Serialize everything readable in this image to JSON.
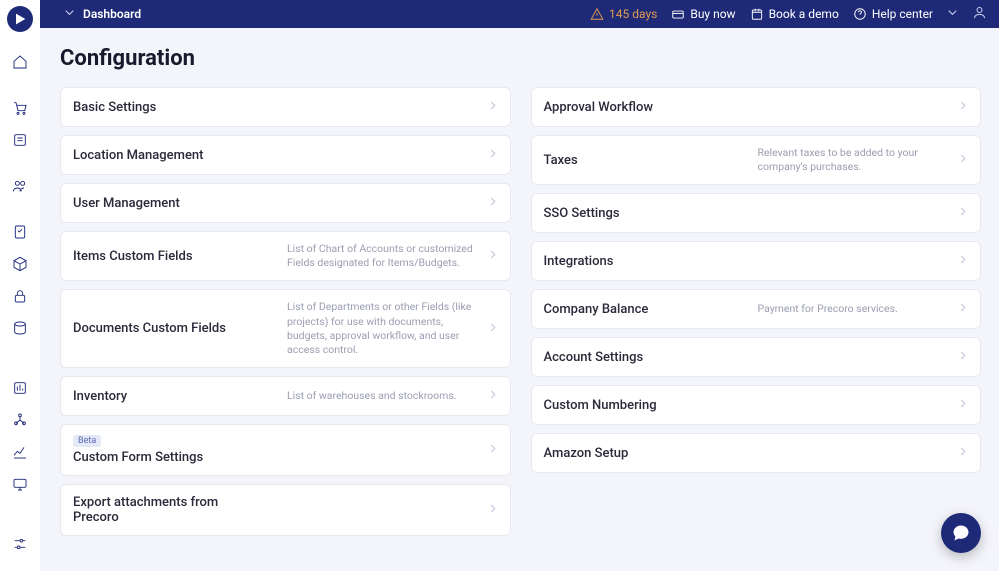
{
  "breadcrumb": "Dashboard",
  "topbar": {
    "trial": "145 days",
    "buy": "Buy now",
    "demo": "Book a demo",
    "help": "Help center"
  },
  "page": {
    "title": "Configuration"
  },
  "left_cards": [
    {
      "title": "Basic Settings",
      "desc": ""
    },
    {
      "title": "Location Management",
      "desc": ""
    },
    {
      "title": "User Management",
      "desc": ""
    },
    {
      "title": "Items Custom Fields",
      "desc": "List of Chart of Accounts or customized Fields designated for Items/Budgets."
    },
    {
      "title": "Documents Custom Fields",
      "desc": "List of Departments or other Fields (like projects) for use with documents, budgets, approval workflow, and user access control."
    },
    {
      "title": "Inventory",
      "desc": "List of warehouses and stockrooms."
    },
    {
      "title": "Custom Form Settings",
      "desc": "",
      "badge": "Beta"
    },
    {
      "title": "Export attachments from Precoro",
      "desc": ""
    }
  ],
  "right_cards": [
    {
      "title": "Approval Workflow",
      "desc": ""
    },
    {
      "title": "Taxes",
      "desc": "Relevant taxes to be added to your company's purchases."
    },
    {
      "title": "SSO Settings",
      "desc": ""
    },
    {
      "title": "Integrations",
      "desc": ""
    },
    {
      "title": "Company Balance",
      "desc": "Payment for Precoro services."
    },
    {
      "title": "Account Settings",
      "desc": ""
    },
    {
      "title": "Custom Numbering",
      "desc": ""
    },
    {
      "title": "Amazon Setup",
      "desc": ""
    }
  ],
  "sidebar_icons": [
    "home",
    "cart",
    "budget",
    "users",
    "checklist",
    "package",
    "lock",
    "database",
    "",
    "reports",
    "org",
    "analytics",
    "display",
    "",
    "settings"
  ]
}
